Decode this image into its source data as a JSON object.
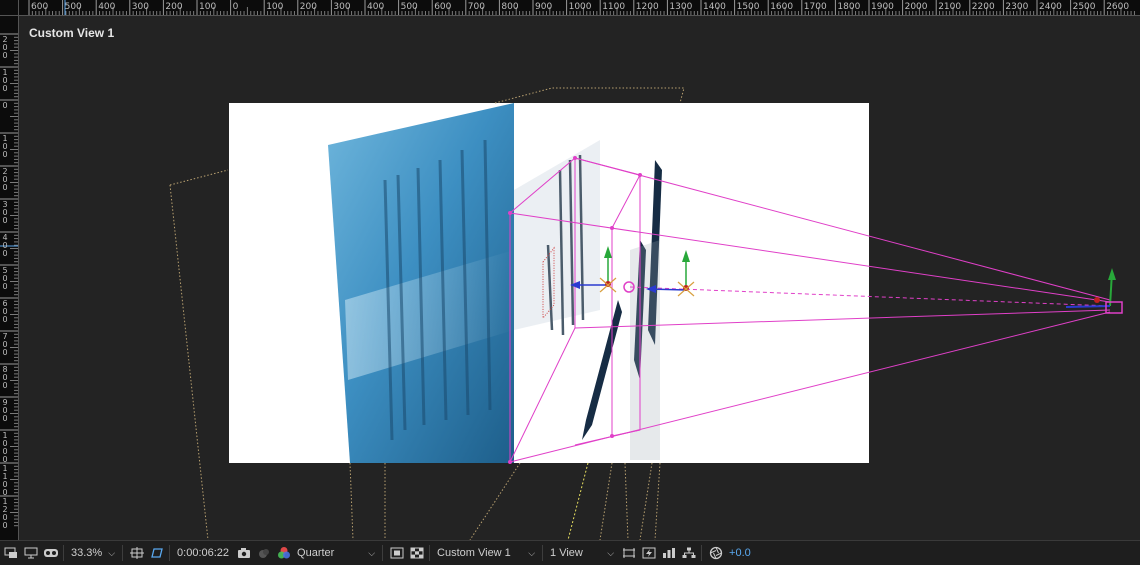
{
  "ruler": {
    "top_labels": [
      "600",
      "500",
      "400",
      "300",
      "200",
      "100",
      "0",
      "100",
      "200",
      "300",
      "400",
      "500",
      "600",
      "700",
      "800",
      "900",
      "1000",
      "1100",
      "1200",
      "1300",
      "1400",
      "1500",
      "1600",
      "1700",
      "1800",
      "1900",
      "2000",
      "2100",
      "2200",
      "2300",
      "2400",
      "2500",
      "2600"
    ],
    "left_labels": [
      "2\n0\n0",
      "1\n0\n0",
      "0",
      "1\n0\n0",
      "2\n0\n0",
      "3\n0\n0",
      "4\n0\n0",
      "5\n0\n0",
      "6\n0\n0",
      "7\n0\n0",
      "8\n0\n0",
      "9\n0\n0",
      "1\n0\n0\n0",
      "1\n1\n0\n0",
      "1\n2\n0\n0"
    ]
  },
  "viewer": {
    "view_name": "Custom View 1"
  },
  "toolbar": {
    "zoom": "33.3%",
    "timecode": "0:00:06:22",
    "resolution": "Quarter",
    "view": "Custom View 1",
    "layout": "1 View",
    "exposure": "+0.0"
  },
  "colors": {
    "accent": "#5aa9f0",
    "camera_outline": "#e040c8",
    "bounds_dotted": "#b8a070"
  }
}
